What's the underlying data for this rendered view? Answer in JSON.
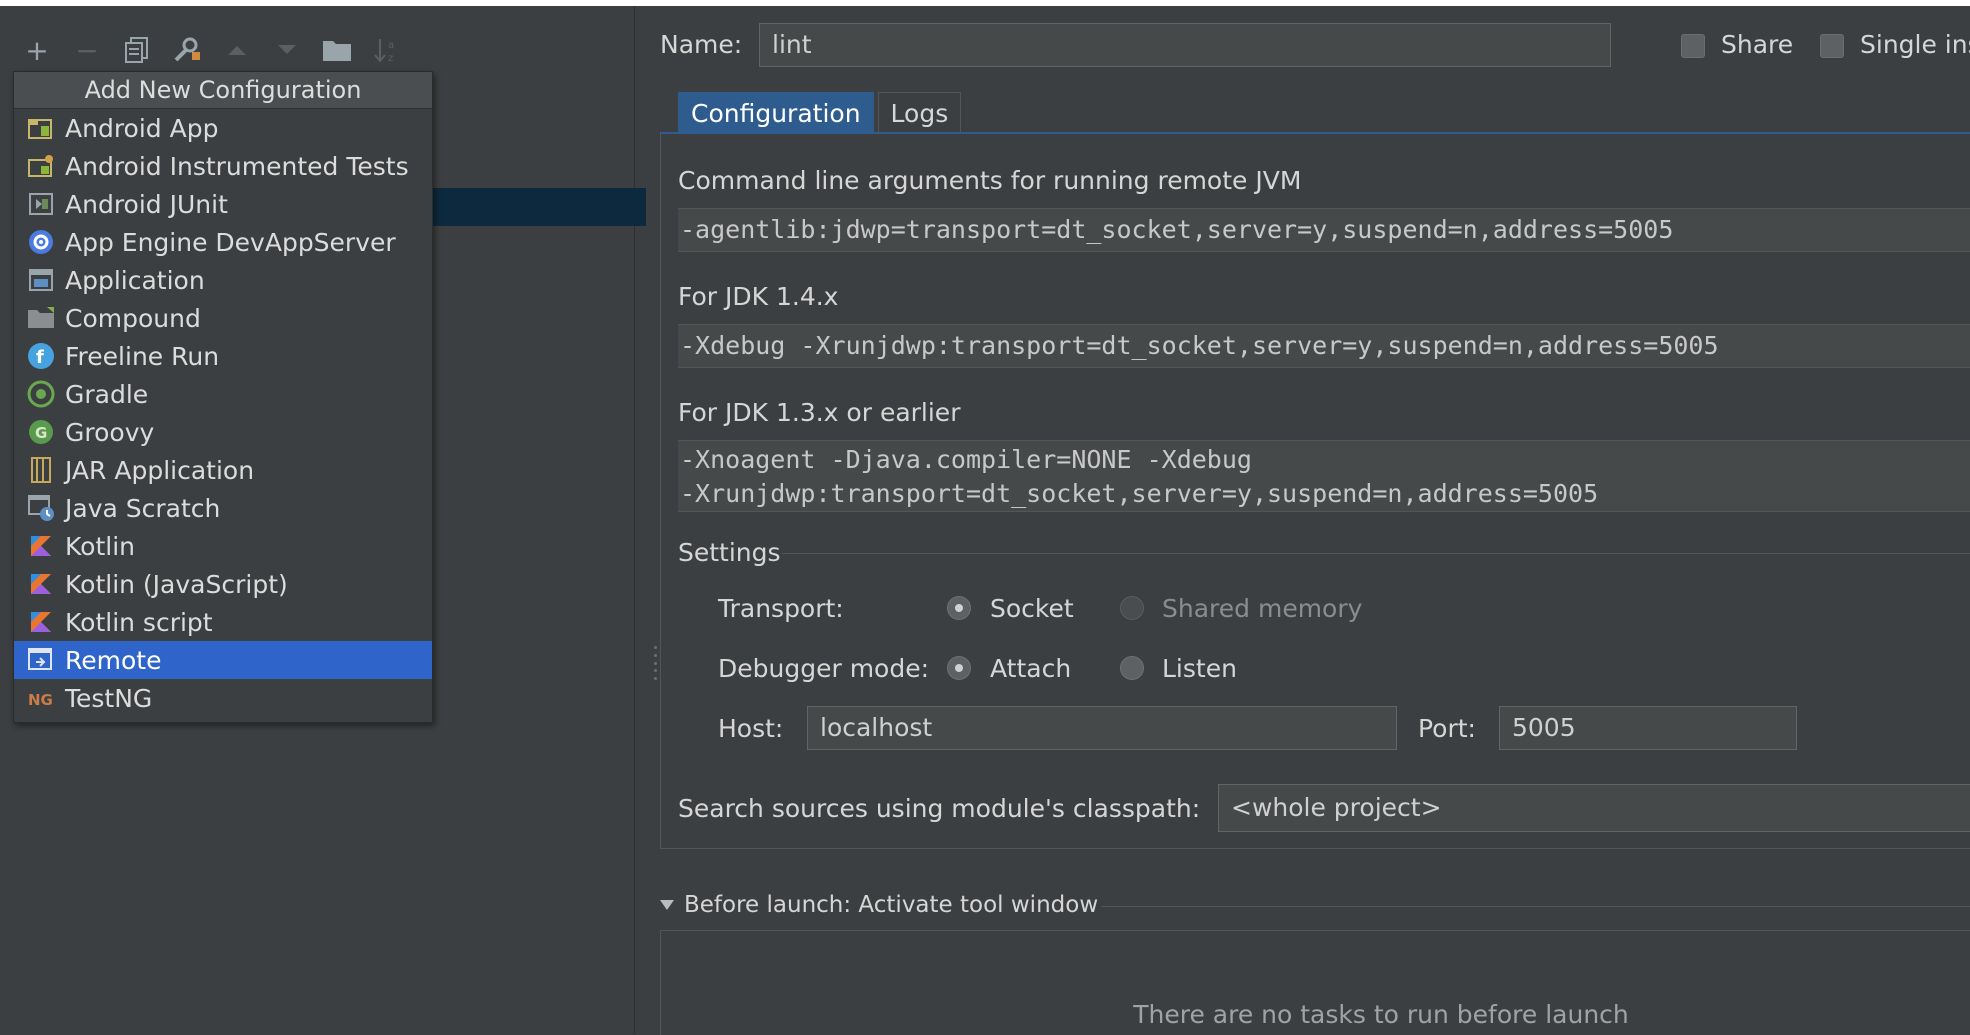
{
  "toolbar": {
    "add": "+",
    "remove": "−"
  },
  "popup": {
    "title": "Add New Configuration",
    "items": [
      {
        "label": "Android App",
        "icon": "android-app-icon"
      },
      {
        "label": "Android Instrumented Tests",
        "icon": "android-tests-icon"
      },
      {
        "label": "Android JUnit",
        "icon": "junit-icon"
      },
      {
        "label": "App Engine DevAppServer",
        "icon": "app-engine-icon"
      },
      {
        "label": "Application",
        "icon": "application-icon"
      },
      {
        "label": "Compound",
        "icon": "folder-icon"
      },
      {
        "label": "Freeline Run",
        "icon": "freeline-icon"
      },
      {
        "label": "Gradle",
        "icon": "gradle-icon"
      },
      {
        "label": "Groovy",
        "icon": "groovy-icon"
      },
      {
        "label": "JAR Application",
        "icon": "jar-icon"
      },
      {
        "label": "Java Scratch",
        "icon": "java-scratch-icon"
      },
      {
        "label": "Kotlin",
        "icon": "kotlin-icon"
      },
      {
        "label": "Kotlin (JavaScript)",
        "icon": "kotlin-icon"
      },
      {
        "label": "Kotlin script",
        "icon": "kotlin-icon"
      },
      {
        "label": "Remote",
        "icon": "remote-icon",
        "selected": true
      },
      {
        "label": "TestNG",
        "icon": "testng-icon"
      }
    ]
  },
  "header": {
    "name_label": "Name:",
    "name_value": "lint",
    "share_label": "Share",
    "single_label": "Single ins"
  },
  "tabs": [
    "Configuration",
    "Logs"
  ],
  "config": {
    "cmd_label": "Command line arguments for running remote JVM",
    "cmd_value": "-agentlib:jdwp=transport=dt_socket,server=y,suspend=n,address=5005",
    "jdk14_label": "For JDK 1.4.x",
    "jdk14_value": "-Xdebug -Xrunjdwp:transport=dt_socket,server=y,suspend=n,address=5005",
    "jdk13_label": "For JDK 1.3.x or earlier",
    "jdk13_line1": "-Xnoagent -Djava.compiler=NONE -Xdebug",
    "jdk13_line2": "-Xrunjdwp:transport=dt_socket,server=y,suspend=n,address=5005",
    "settings_label": "Settings",
    "transport_label": "Transport:",
    "transport_socket": "Socket",
    "transport_shared": "Shared memory",
    "debugger_label": "Debugger mode:",
    "debugger_attach": "Attach",
    "debugger_listen": "Listen",
    "host_label": "Host:",
    "host_value": "localhost",
    "port_label": "Port:",
    "port_value": "5005",
    "classpath_label": "Search sources using module's classpath:",
    "classpath_value": "<whole project>"
  },
  "before_launch": {
    "title": "Before launch: Activate tool window",
    "empty": "There are no tasks to run before launch"
  },
  "colors": {
    "background": "#3c3f41",
    "selection": "#2f65ca",
    "tab_active": "#2f5c8f",
    "field": "#45494a"
  }
}
